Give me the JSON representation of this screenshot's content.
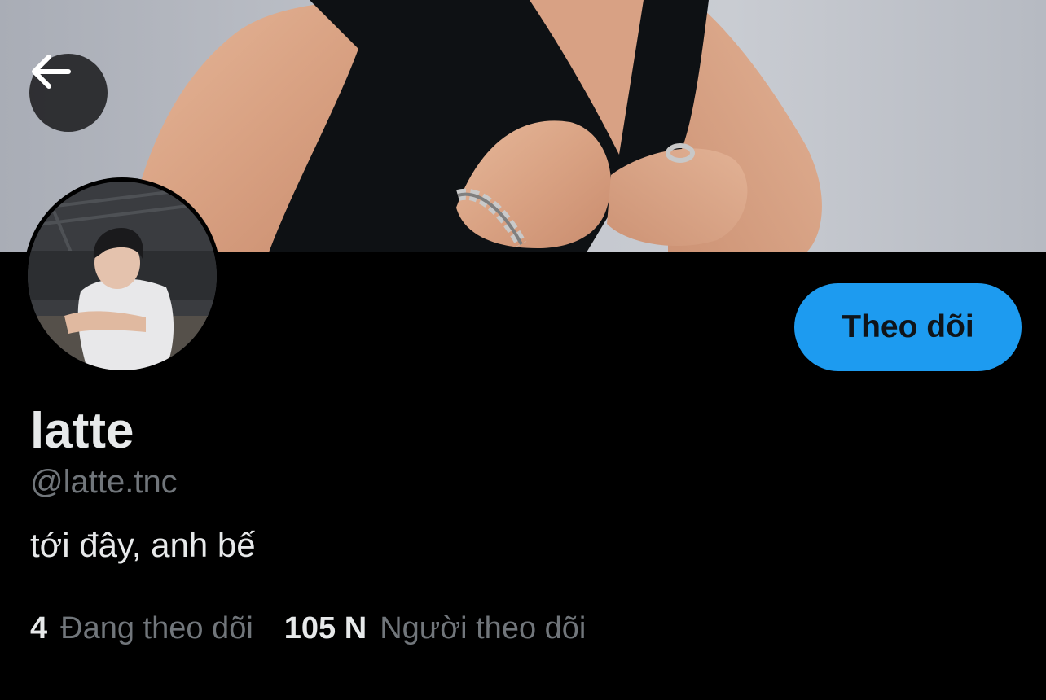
{
  "profile": {
    "display_name": "latte",
    "handle": "@latte.tnc",
    "bio": "tới đây, anh bế"
  },
  "actions": {
    "follow_label": "Theo dõi"
  },
  "stats": {
    "following_count": "4",
    "following_label": "Đang theo dõi",
    "followers_count": "105 N",
    "followers_label": "Người theo dõi"
  },
  "icons": {
    "back": "arrow-left-icon"
  },
  "colors": {
    "accent": "#1d9bf0",
    "background": "#000000",
    "primary_text": "#e7e9ea",
    "secondary_text": "#71767b"
  }
}
